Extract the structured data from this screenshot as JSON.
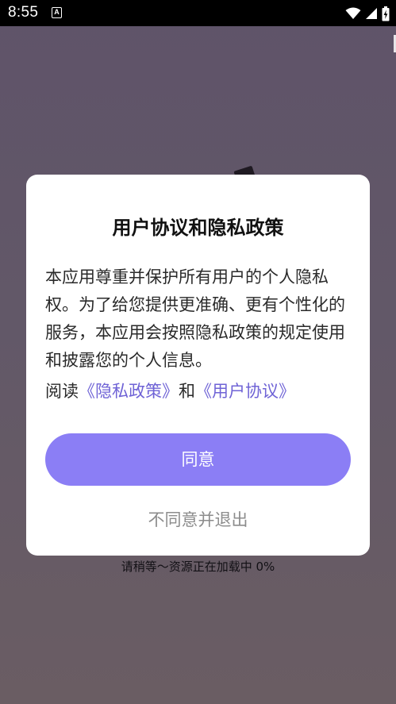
{
  "status_bar": {
    "time": "8:55",
    "notification_glyph": "A",
    "icons": [
      "wifi-icon",
      "signal-icon",
      "battery-charging-icon"
    ]
  },
  "dialog": {
    "title": "用户协议和隐私政策",
    "body": "本应用尊重并保护所有用户的个人隐私权。为了给您提供更准确、更有个性化的服务，本应用会按照隐私政策的规定使用和披露您的个人信息。",
    "read_prefix": "阅读",
    "privacy_link": "《隐私政策》",
    "conjunction": "和",
    "agreement_link": "《用户协议》",
    "agree_label": "同意",
    "decline_label": "不同意并退出"
  },
  "loading": {
    "text": "请稍等～资源正在加载中 0%"
  },
  "colors": {
    "accent": "#8b7ef5",
    "link": "#6f63d6",
    "decline_text": "#8c8c8c",
    "backdrop": "#625868"
  }
}
